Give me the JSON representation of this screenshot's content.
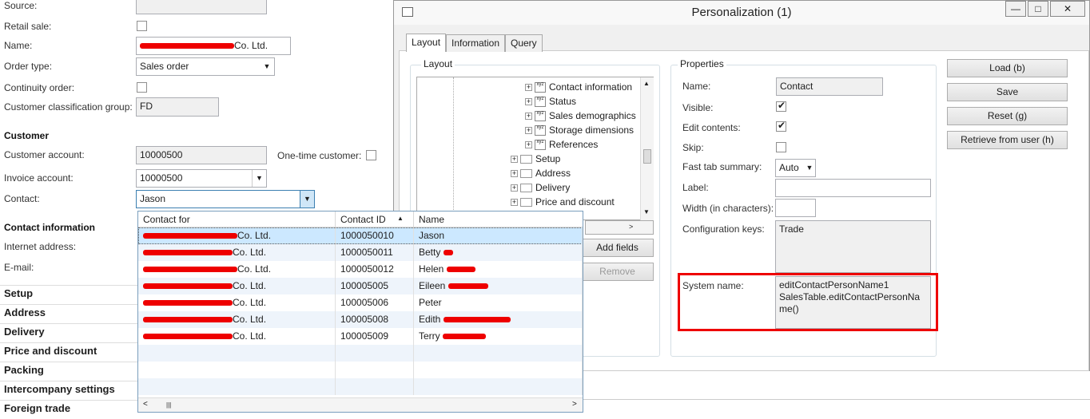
{
  "form": {
    "source_label": "Source:",
    "retail_label": "Retail sale:",
    "name_label": "Name:",
    "name_value": "Co. Ltd.",
    "order_type_label": "Order type:",
    "order_type_value": "Sales order",
    "continuity_label": "Continuity order:",
    "classification_label": "Customer classification group:",
    "classification_value": "FD",
    "customer_heading": "Customer",
    "account_label": "Customer account:",
    "account_value": "10000500",
    "onetime_label": "One-time customer:",
    "invoice_label": "Invoice account:",
    "invoice_value": "10000500",
    "contact_label": "Contact:",
    "contact_value": "Jason",
    "contact_info_heading": "Contact information",
    "internet_label": "Internet address:",
    "email_label": "E-mail:"
  },
  "sections": [
    "Setup",
    "Address",
    "Delivery",
    "Price and discount",
    "Packing",
    "Intercompany settings",
    "Foreign trade"
  ],
  "grid": {
    "headers": [
      "Contact for",
      "Contact ID",
      "Name"
    ],
    "rows": [
      {
        "company": "Co. Ltd.",
        "id": "1000050010",
        "name": "Jason"
      },
      {
        "company": "Co. Ltd.",
        "id": "1000050011",
        "name": "Betty"
      },
      {
        "company": "Co. Ltd.",
        "id": "1000050012",
        "name": "Helen"
      },
      {
        "company": "Co. Ltd.",
        "id": "100005005",
        "name": "Eileen"
      },
      {
        "company": "Co. Ltd.",
        "id": "100005006",
        "name": "Peter"
      },
      {
        "company": "Co. Ltd.",
        "id": "100005008",
        "name": "Edith"
      },
      {
        "company": "Co. Ltd.",
        "id": "100005009",
        "name": "Terry"
      }
    ]
  },
  "window": {
    "title": "Personalization (1)",
    "tabs": [
      "Layout",
      "Information",
      "Query"
    ],
    "layout_group": "Layout",
    "tree": [
      "Contact information",
      "Status",
      "Sales demographics",
      "Storage dimensions",
      "References",
      "Setup",
      "Address",
      "Delivery",
      "Price and discount"
    ],
    "add_fields": "Add fields",
    "remove": "Remove",
    "properties_group": "Properties",
    "name_label": "Name:",
    "name_value": "Contact",
    "visible_label": "Visible:",
    "edit_label": "Edit contents:",
    "skip_label": "Skip:",
    "fasttab_label": "Fast tab summary:",
    "fasttab_value": "Auto",
    "label_label": "Label:",
    "width_label": "Width (in characters):",
    "config_label": "Configuration keys:",
    "config_value": "Trade",
    "system_label": "System name:",
    "system_line1": "editContactPersonName1",
    "system_line2": "SalesTable.editContactPersonName()",
    "load": "Load (b)",
    "save": "Save",
    "reset": "Reset (g)",
    "retrieve": "Retrieve from user (h)",
    "min": "—",
    "max": "□",
    "close": "✕"
  },
  "colors": {
    "highlight": "#e00000",
    "selected_row": "#cce8ff"
  }
}
